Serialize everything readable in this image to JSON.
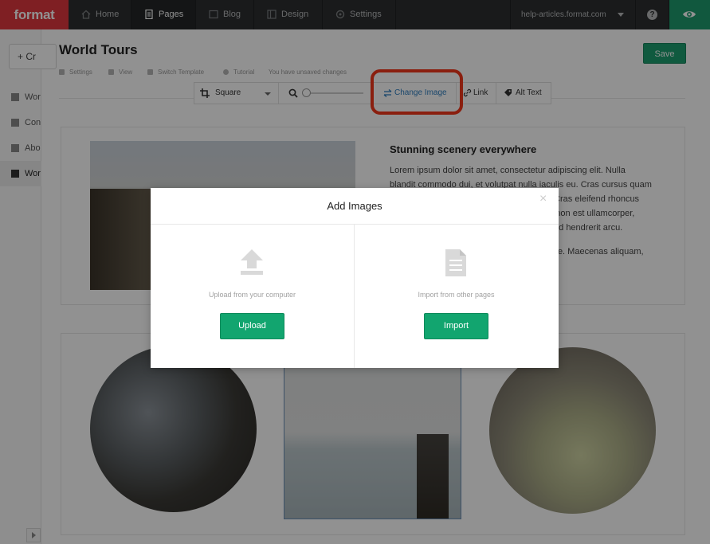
{
  "nav": {
    "logo": "format",
    "items": [
      {
        "label": "Home"
      },
      {
        "label": "Pages"
      },
      {
        "label": "Blog"
      },
      {
        "label": "Design"
      },
      {
        "label": "Settings"
      }
    ],
    "site": "help-articles.format.com",
    "help": "?"
  },
  "sidebar": {
    "create_label": "+ Cr",
    "items": [
      {
        "label": "Wor"
      },
      {
        "label": "Con"
      },
      {
        "label": "Abo"
      },
      {
        "label": "Wor"
      }
    ]
  },
  "page": {
    "title": "World Tours",
    "save_label": "Save",
    "subbar": {
      "settings": "Settings",
      "view": "View",
      "switch_template": "Switch Template",
      "tutorial": "Tutorial",
      "status": "You have unsaved changes"
    }
  },
  "toolbar": {
    "shape": "Square",
    "change_image": "Change Image",
    "link": "Link",
    "alt_text": "Alt Text"
  },
  "content": {
    "heading": "Stunning scenery everywhere",
    "paragraph1": "Lorem ipsum dolor sit amet, consectetur adipiscing elit. Nulla blandit commodo dui, et volutpat nulla iaculis eu. Cras cursus quam eu ante semper, nec pulvinar mi tincidunt. Cras eleifend rhoncus nisi, a vehicula leo tincidunt quis. Vivamus non est ullamcorper, aliquam diam vel, fermentum nunc. Nam sed hendrerit arcu.",
    "paragraph2": "Morbi commodo faucibus eros. Pellentesque. Maecenas aliquam, dui et volutpat fringilla non."
  },
  "modal": {
    "title": "Add Images",
    "close": "×",
    "upload_label": "Upload from your computer",
    "upload_button": "Upload",
    "import_label": "Import from other pages",
    "import_button": "Import"
  },
  "colors": {
    "brand_red": "#e0383e",
    "accent_green": "#1d9f6f",
    "highlight_red": "#f2381b",
    "link_blue": "#2f7ebf"
  }
}
